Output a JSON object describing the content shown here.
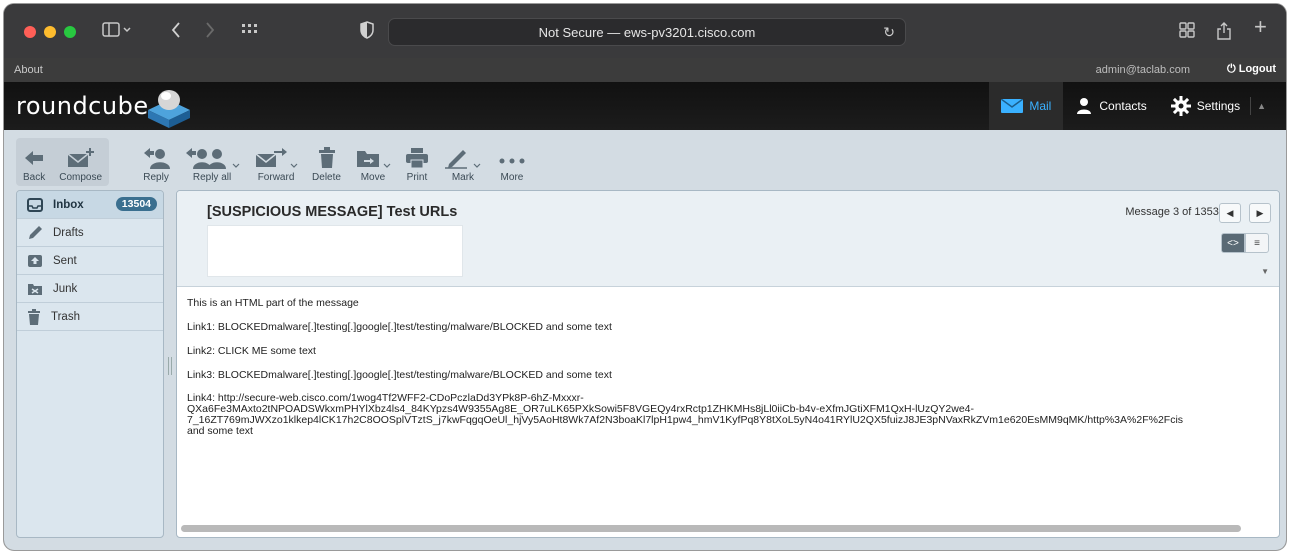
{
  "browser": {
    "url_text": "Not Secure — ews-pv3201.cisco.com"
  },
  "topline": {
    "about": "About",
    "user": "admin@taclab.com",
    "logout": "Logout"
  },
  "header": {
    "logo": "roundcube",
    "tasks": [
      {
        "label": "Mail",
        "icon": "mail-icon",
        "active": true
      },
      {
        "label": "Contacts",
        "icon": "contacts-icon",
        "active": false
      },
      {
        "label": "Settings",
        "icon": "gear-icon",
        "active": false
      }
    ]
  },
  "toolbar": {
    "back": "Back",
    "compose": "Compose",
    "reply": "Reply",
    "reply_all": "Reply all",
    "forward": "Forward",
    "delete": "Delete",
    "move": "Move",
    "print": "Print",
    "mark": "Mark",
    "more": "More"
  },
  "folders": [
    {
      "label": "Inbox",
      "icon": "inbox-icon",
      "count": "13504",
      "active": true
    },
    {
      "label": "Drafts",
      "icon": "pencil-icon"
    },
    {
      "label": "Sent",
      "icon": "sent-icon"
    },
    {
      "label": "Junk",
      "icon": "junk-icon"
    },
    {
      "label": "Trash",
      "icon": "trash-icon"
    }
  ],
  "message": {
    "subject": "[SUSPICIOUS MESSAGE] Test URLs",
    "counter": "Message 3 of 13531",
    "body": {
      "line0": "This is an HTML part of the message",
      "line1": "Link1: BLOCKEDmalware[.]testing[.]google[.]test/testing/malware/BLOCKED and some text",
      "line2": "Link2: CLICK ME some text",
      "line3": "Link3: BLOCKEDmalware[.]testing[.]google[.]test/testing/malware/BLOCKED and some text",
      "line4a": "Link4: http://secure-web.cisco.com/1wog4Tf2WFF2-CDoPczlaDd3YPk8P-6hZ-Mxxxr-",
      "line4b": "QXa6Fe3MAxto2tNPOADSWkxmPHYlXbz4ls4_84KYpzs4W9355Ag8E_OR7uLK65PXkSowi5F8VGEQy4rxRctp1ZHKMHs8jLl0iiCb-b4v-eXfmJGtiXFM1QxH-lUzQY2we4-",
      "line4c": "7_16ZT769mJWXzo1klkep4lCK17h2C8OOSplVTztS_j7kwFqgqOeUl_hjVy5AoHt8Wk7Af2N3boaKl7lpH1pw4_hmV1KyfPq8Y8tXoL5yN4o41RYlU2QX5fuizJ8JE3pNVaxRkZVm1e620EsMM9qMK/http%3A%2F%2Fcis",
      "line4d": "and some text"
    }
  }
}
